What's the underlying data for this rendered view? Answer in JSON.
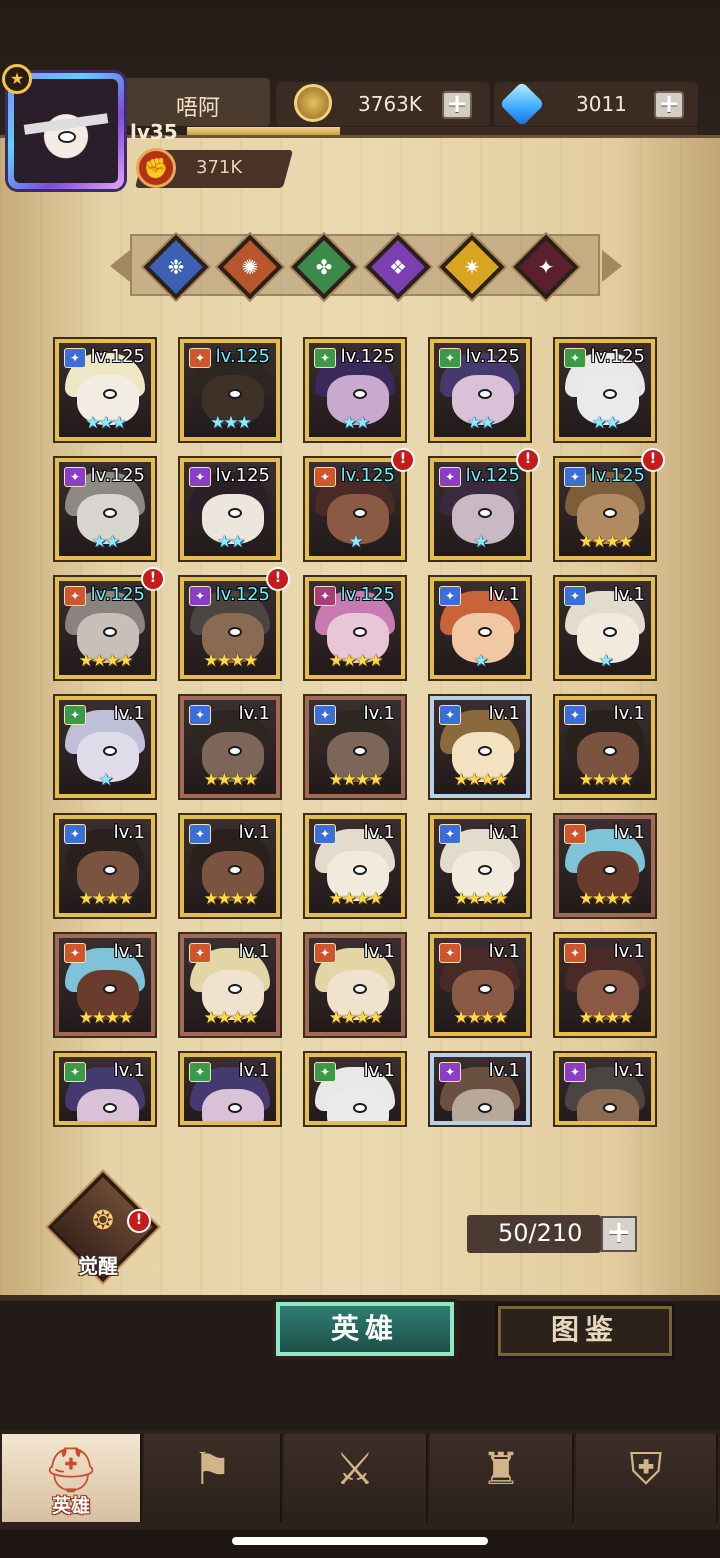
{
  "player": {
    "name": "唔阿",
    "level": "lv35",
    "xp_progress": 0.3,
    "power": "371K"
  },
  "resources": {
    "coins": "3763K",
    "gems": "3011"
  },
  "faction_filters": [
    {
      "icon": "ice-faction-icon",
      "color": "#3c5fb2"
    },
    {
      "icon": "fire-faction-icon",
      "color": "#b8562d"
    },
    {
      "icon": "nature-faction-icon",
      "color": "#3b8a4a"
    },
    {
      "icon": "shadow-faction-icon",
      "color": "#7a3fb0"
    },
    {
      "icon": "light-faction-icon",
      "color": "#d8a520"
    },
    {
      "icon": "chaos-faction-icon",
      "color": "#5b2030"
    }
  ],
  "heroes": [
    {
      "level": "lv.125",
      "stars": "★★★",
      "tier": "blue",
      "frame": "gold",
      "class_color": "#3b6ed8",
      "hair": "#efe6c6",
      "skin": "#f3ece2",
      "alert": false,
      "hi": false
    },
    {
      "level": "lv.125",
      "stars": "★★★",
      "tier": "blue",
      "frame": "gold",
      "class_color": "#d0552c",
      "hair": "#2e2620",
      "skin": "#3d3128",
      "alert": false,
      "hi": true
    },
    {
      "level": "lv.125",
      "stars": "★★",
      "tier": "blue",
      "frame": "gold",
      "class_color": "#3b9a4a",
      "hair": "#3a2a5c",
      "skin": "#c9a9d0",
      "alert": false,
      "hi": false
    },
    {
      "level": "lv.125",
      "stars": "★★",
      "tier": "blue",
      "frame": "gold",
      "class_color": "#3b9a4a",
      "hair": "#453a6e",
      "skin": "#d9c1d8",
      "alert": false,
      "hi": false
    },
    {
      "level": "lv.125",
      "stars": "★★",
      "tier": "blue",
      "frame": "gold",
      "class_color": "#3b9a4a",
      "hair": "#e8e8e8",
      "skin": "#eaeaea",
      "alert": false,
      "hi": false
    },
    {
      "level": "lv.125",
      "stars": "★★",
      "tier": "blue",
      "frame": "gold",
      "class_color": "#8a3ec7",
      "hair": "#8d8a86",
      "skin": "#d8d4cf",
      "alert": false,
      "hi": false
    },
    {
      "level": "lv.125",
      "stars": "★★",
      "tier": "blue",
      "frame": "gold",
      "class_color": "#8a3ec7",
      "hair": "#2c2028",
      "skin": "#ece6dd",
      "alert": false,
      "hi": false
    },
    {
      "level": "lv.125",
      "stars": "★",
      "tier": "blue",
      "frame": "gold",
      "class_color": "#d0552c",
      "hair": "#4a2a26",
      "skin": "#8a5a44",
      "alert": true,
      "hi": true
    },
    {
      "level": "lv.125",
      "stars": "★",
      "tier": "blue",
      "frame": "gold",
      "class_color": "#8a3ec7",
      "hair": "#3a2a3e",
      "skin": "#c8b9c5",
      "alert": true,
      "hi": true
    },
    {
      "level": "lv.125",
      "stars": "★★★★",
      "tier": "gold",
      "frame": "gold",
      "class_color": "#3b6ed8",
      "hair": "#7d5e3a",
      "skin": "#b08a60",
      "alert": true,
      "hi": true
    },
    {
      "level": "lv.125",
      "stars": "★★★★",
      "tier": "gold",
      "frame": "gold",
      "class_color": "#d0552c",
      "hair": "#8a8480",
      "skin": "#c8c0b8",
      "alert": true,
      "hi": true
    },
    {
      "level": "lv.125",
      "stars": "★★★★",
      "tier": "gold",
      "frame": "gold",
      "class_color": "#8a3ec7",
      "hair": "#4a4540",
      "skin": "#8a6a52",
      "alert": true,
      "hi": true
    },
    {
      "level": "lv.125",
      "stars": "★★★★",
      "tier": "gold",
      "frame": "gold",
      "class_color": "#a83c7a",
      "hair": "#c77bb2",
      "skin": "#e8c6d6",
      "alert": false,
      "hi": true
    },
    {
      "level": "lv.1",
      "stars": "★",
      "tier": "blue",
      "frame": "gold",
      "class_color": "#3b6ed8",
      "hair": "#c7643a",
      "skin": "#f0c9a4",
      "alert": false,
      "hi": false
    },
    {
      "level": "lv.1",
      "stars": "★",
      "tier": "blue",
      "frame": "gold",
      "class_color": "#3b6ed8",
      "hair": "#e3dccc",
      "skin": "#f2eadd",
      "alert": false,
      "hi": false
    },
    {
      "level": "lv.1",
      "stars": "★",
      "tier": "blue",
      "frame": "gold",
      "class_color": "#3b9a4a",
      "hair": "#bfbfd8",
      "skin": "#e0dbe8",
      "alert": false,
      "hi": false
    },
    {
      "level": "lv.1",
      "stars": "★★★★",
      "tier": "gold",
      "frame": "bronze",
      "class_color": "#3b6ed8",
      "hair": "#2e2620",
      "skin": "#7d6658",
      "alert": false,
      "hi": false
    },
    {
      "level": "lv.1",
      "stars": "★★★★",
      "tier": "gold",
      "frame": "bronze",
      "class_color": "#3b6ed8",
      "hair": "#2e2620",
      "skin": "#7d6658",
      "alert": false,
      "hi": false
    },
    {
      "level": "lv.1",
      "stars": "★★★★",
      "tier": "gold",
      "frame": "silver",
      "class_color": "#3b6ed8",
      "hair": "#8a6a3a",
      "skin": "#f2e2c2",
      "alert": false,
      "hi": false
    },
    {
      "level": "lv.1",
      "stars": "★★★★",
      "tier": "gold",
      "frame": "gold",
      "class_color": "#3b6ed8",
      "hair": "#2a201c",
      "skin": "#7a5440",
      "alert": false,
      "hi": false
    },
    {
      "level": "lv.1",
      "stars": "★★★★",
      "tier": "gold",
      "frame": "gold",
      "class_color": "#3b6ed8",
      "hair": "#2a201c",
      "skin": "#7a5440",
      "alert": false,
      "hi": false
    },
    {
      "level": "lv.1",
      "stars": "★★★★",
      "tier": "gold",
      "frame": "gold",
      "class_color": "#3b6ed8",
      "hair": "#2a201c",
      "skin": "#7a5440",
      "alert": false,
      "hi": false
    },
    {
      "level": "lv.1",
      "stars": "★★★★",
      "tier": "gold",
      "frame": "gold",
      "class_color": "#3b6ed8",
      "hair": "#e3dccc",
      "skin": "#f2eadd",
      "alert": false,
      "hi": false
    },
    {
      "level": "lv.1",
      "stars": "★★★★",
      "tier": "gold",
      "frame": "gold",
      "class_color": "#3b6ed8",
      "hair": "#e3dccc",
      "skin": "#f2eadd",
      "alert": false,
      "hi": false
    },
    {
      "level": "lv.1",
      "stars": "★★★★",
      "tier": "gold",
      "frame": "bronze",
      "class_color": "#d0552c",
      "hair": "#7fc3d8",
      "skin": "#6a3c2e",
      "alert": false,
      "hi": false
    },
    {
      "level": "lv.1",
      "stars": "★★★★",
      "tier": "gold",
      "frame": "bronze",
      "class_color": "#d0552c",
      "hair": "#7fc3d8",
      "skin": "#6a3c2e",
      "alert": false,
      "hi": false
    },
    {
      "level": "lv.1",
      "stars": "★★★★",
      "tier": "gold",
      "frame": "bronze",
      "class_color": "#d0552c",
      "hair": "#e2d6a6",
      "skin": "#f0e2cc",
      "alert": false,
      "hi": false
    },
    {
      "level": "lv.1",
      "stars": "★★★★",
      "tier": "gold",
      "frame": "bronze",
      "class_color": "#d0552c",
      "hair": "#e2d6a6",
      "skin": "#f0e2cc",
      "alert": false,
      "hi": false
    },
    {
      "level": "lv.1",
      "stars": "★★★★",
      "tier": "gold",
      "frame": "gold",
      "class_color": "#d0552c",
      "hair": "#4a2a26",
      "skin": "#8a5a44",
      "alert": false,
      "hi": false
    },
    {
      "level": "lv.1",
      "stars": "★★★★",
      "tier": "gold",
      "frame": "gold",
      "class_color": "#d0552c",
      "hair": "#4a2a26",
      "skin": "#8a5a44",
      "alert": false,
      "hi": false
    },
    {
      "level": "lv.1",
      "stars": "",
      "tier": "gold",
      "frame": "gold",
      "class_color": "#3b9a4a",
      "hair": "#453a6e",
      "skin": "#d9c1d8",
      "alert": false,
      "hi": false
    },
    {
      "level": "lv.1",
      "stars": "",
      "tier": "gold",
      "frame": "gold",
      "class_color": "#3b9a4a",
      "hair": "#453a6e",
      "skin": "#d9c1d8",
      "alert": false,
      "hi": false
    },
    {
      "level": "lv.1",
      "stars": "",
      "tier": "gold",
      "frame": "gold",
      "class_color": "#3b9a4a",
      "hair": "#e8e8e8",
      "skin": "#eaeaea",
      "alert": false,
      "hi": false
    },
    {
      "level": "lv.1",
      "stars": "",
      "tier": "gold",
      "frame": "silver",
      "class_color": "#8a3ec7",
      "hair": "#6a5040",
      "skin": "#b8a89a",
      "alert": false,
      "hi": false
    },
    {
      "level": "lv.1",
      "stars": "",
      "tier": "gold",
      "frame": "gold",
      "class_color": "#8a3ec7",
      "hair": "#4a4540",
      "skin": "#8a6a52",
      "alert": false,
      "hi": false
    }
  ],
  "awaken": {
    "label": "觉醒"
  },
  "hero_count": "50/210",
  "tabs": {
    "heroes": "英雄",
    "codex": "图鉴"
  },
  "bottom_nav": [
    {
      "label": "英雄",
      "icon": "helmet-icon",
      "glyph": "⛑"
    },
    {
      "label": "",
      "icon": "map-icon",
      "glyph": "⚑"
    },
    {
      "label": "",
      "icon": "crossed-swords-icon",
      "glyph": "⚔"
    },
    {
      "label": "",
      "icon": "castle-icon",
      "glyph": "♜"
    },
    {
      "label": "",
      "icon": "guild-icon",
      "glyph": "⛨"
    }
  ]
}
